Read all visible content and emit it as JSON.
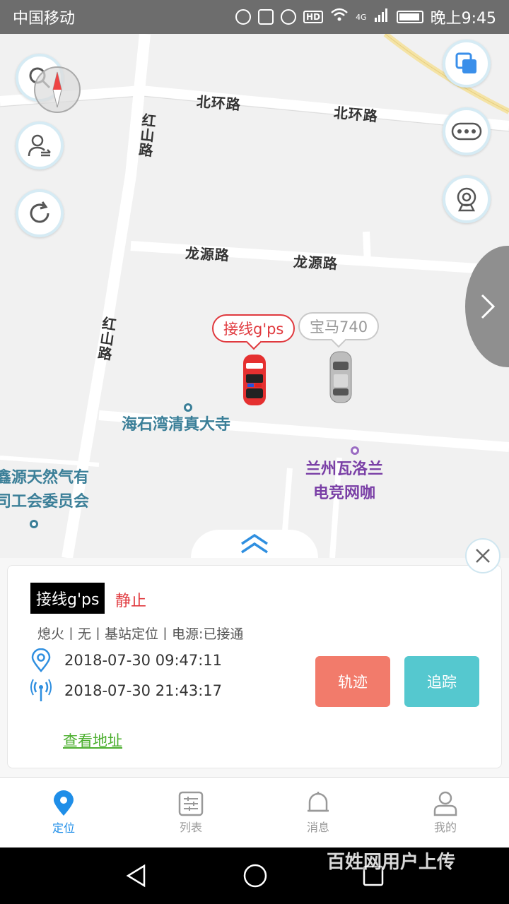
{
  "status_bar": {
    "carrier": "中国移动",
    "network": "4G",
    "hd": "HD",
    "time": "晚上9:45"
  },
  "map": {
    "roads": [
      {
        "name": "北环路"
      },
      {
        "name": "北环路"
      },
      {
        "name": "红山路"
      },
      {
        "name": "龙源路"
      },
      {
        "name": "龙源路"
      },
      {
        "name": "红山路"
      }
    ],
    "pois": [
      {
        "name": "海石湾清真大寺",
        "color": "#3b7f98"
      },
      {
        "name": "兰州瓦洛兰\n电竞网咖",
        "color": "#7a3fa6"
      },
      {
        "name": "鑫源天然气有\n司工会委员会",
        "color": "#3b7f98"
      }
    ],
    "vehicles": [
      {
        "label": "接线g'ps",
        "color": "#e0393e",
        "selected": true
      },
      {
        "label": "宝马740",
        "color": "#999999",
        "selected": false
      }
    ],
    "left_buttons": [
      "search-icon",
      "user-switch-icon",
      "refresh-icon"
    ],
    "right_buttons": [
      "layers-icon",
      "more-icon",
      "camera-icon"
    ]
  },
  "panel": {
    "device_name": "接线g'ps",
    "status": "静止",
    "info": "熄火丨无丨基站定位丨电源:已接通",
    "location_time": "2018-07-30 09:47:11",
    "signal_time": "2018-07-30 21:43:17",
    "view_address": "查看地址",
    "track_button": "轨迹",
    "follow_button": "追踪"
  },
  "tabs": [
    {
      "label": "定位",
      "icon": "location-icon",
      "active": true
    },
    {
      "label": "列表",
      "icon": "list-icon",
      "active": false
    },
    {
      "label": "消息",
      "icon": "bell-icon",
      "active": false
    },
    {
      "label": "我的",
      "icon": "user-icon",
      "active": false
    }
  ],
  "watermark": "百姓网用户上传",
  "colors": {
    "accent": "#1f8ee8",
    "status_red": "#e0393e",
    "track": "#f27b6b",
    "follow": "#55c8cf",
    "link": "#4caf2f"
  }
}
